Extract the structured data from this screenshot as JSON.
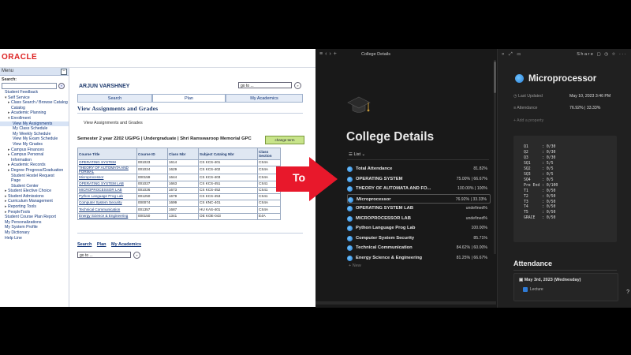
{
  "oracle": {
    "logo": "ORACLE",
    "menu": {
      "title": "Menu",
      "search_label": "Search:",
      "items": [
        {
          "label": "Student Feedback",
          "level": "l0"
        },
        {
          "label": "Self Service",
          "level": "l0",
          "arrow": "▾"
        },
        {
          "label": "Class Search / Browse Catalog",
          "level": "l1",
          "arrow": "▸"
        },
        {
          "label": "Catalog",
          "level": "l2b"
        },
        {
          "label": "Academic Planning",
          "level": "l1",
          "arrow": "▸"
        },
        {
          "label": "Enrollment",
          "level": "l1",
          "arrow": "▾"
        },
        {
          "label": "View My Assignments",
          "level": "l2",
          "selected": true
        },
        {
          "label": "My Class Schedule",
          "level": "l2"
        },
        {
          "label": "My Weekly Schedule",
          "level": "l2"
        },
        {
          "label": "View My Exam Schedule",
          "level": "l2"
        },
        {
          "label": "View My Grades",
          "level": "l2"
        },
        {
          "label": "Campus Finances",
          "level": "l1",
          "arrow": "▸"
        },
        {
          "label": "Campus Personal",
          "level": "l1",
          "arrow": "▸"
        },
        {
          "label": "Information",
          "level": "l2b"
        },
        {
          "label": "Academic Records",
          "level": "l1",
          "arrow": "▸"
        },
        {
          "label": "Degree Progress/Graduation",
          "level": "l1",
          "arrow": "▸"
        },
        {
          "label": "Student Hostel Request",
          "level": "l2b"
        },
        {
          "label": "Page",
          "level": "l2b"
        },
        {
          "label": "Student Center",
          "level": "l2b"
        },
        {
          "label": "Student Elective Choice",
          "level": "l0",
          "arrow": "▸"
        },
        {
          "label": "Student Admissions",
          "level": "l0",
          "arrow": "▸"
        },
        {
          "label": "Curriculum Management",
          "level": "l0",
          "arrow": "▸"
        },
        {
          "label": "Reporting Tools",
          "level": "l0",
          "arrow": "▸"
        },
        {
          "label": "PeopleTools",
          "level": "l0",
          "arrow": "▸"
        },
        {
          "label": "Student Course Plan Report",
          "level": "l0"
        },
        {
          "label": "My Personalizations",
          "level": "l0"
        },
        {
          "label": "My System Profile",
          "level": "l0"
        },
        {
          "label": "My Dictionary",
          "level": "l0"
        },
        {
          "label": "Help Line",
          "level": "l0"
        }
      ]
    },
    "user_name": "ARJUN VARSHNEY",
    "goto": "go to ...",
    "tabs": [
      "Search",
      "Plan",
      "My Academics"
    ],
    "heading": "View Assignments and Grades",
    "sub_heading": "View Assignments and Grades",
    "semester": "Semester 2 year 2202 UG/PG | Undergraduate | Shri Ramswaroop Memorial GPC",
    "change_term": "change term",
    "table": {
      "headers": [
        "Course Title",
        "Course ID",
        "Class Nbr",
        "Subject Catalog Nbr",
        "Class Section"
      ],
      "rows": [
        [
          "OPERATING SYSTEM",
          "001023",
          "1614",
          "CS KCS-401",
          "CS4A"
        ],
        [
          "THEORY OF AUTOMATA AND FORMAL",
          "001024",
          "1629",
          "CS KCS-402",
          "CS4A"
        ],
        [
          "Microprocessor",
          "000159",
          "1644",
          "CS KCS-403",
          "CS4A"
        ],
        [
          "OPERATING SYSTEM LAB",
          "001027",
          "1663",
          "CS KCS-451",
          "CS41"
        ],
        [
          "MICROPROCESSOR LAB",
          "001026",
          "1673",
          "CS KCS-452",
          "CS41"
        ],
        [
          "Python Language Prog Lab",
          "001250",
          "1679",
          "CS KCS-453",
          "CS41"
        ],
        [
          "Computer System Security",
          "000074",
          "1699",
          "CS KNC-401",
          "CS4A"
        ],
        [
          "Technical Communication",
          "001357",
          "1687",
          "HU KAS-401",
          "CS4A"
        ],
        [
          "Energy Science & Engineering",
          "000150",
          "1341",
          "OE KOE-043",
          "E4A"
        ]
      ]
    },
    "bottom_links": [
      "Search",
      "Plan",
      "My Academics"
    ],
    "goto_bottom": "go to ..."
  },
  "arrow_label": "To",
  "notion": {
    "breadcrumb": "College Details",
    "title": "College Details",
    "view_label": "List",
    "rows": [
      {
        "name": "Total Attendance",
        "value": "81.82%"
      },
      {
        "name": "OPERATING SYSTEM",
        "value": "75.00% | 66.67%"
      },
      {
        "name": "THEORY OF AUTOMATA AND FO...",
        "value": "100.00% | 100%"
      },
      {
        "name": "Microprocessor",
        "value": "76.92% | 33.33%",
        "selected": true
      },
      {
        "name": "OPERATING SYSTEM LAB",
        "value": "undefined%"
      },
      {
        "name": "MICROPROCESSOR LAB",
        "value": "undefined%"
      },
      {
        "name": "Python Language Prog Lab",
        "value": "100.00%"
      },
      {
        "name": "Computer System Security",
        "value": "85.71%"
      },
      {
        "name": "Technical Communication",
        "value": "84.62% | 60.00%"
      },
      {
        "name": "Energy Science & Engineering",
        "value": "81.25% | 66.67%"
      }
    ],
    "new_label": "+ New",
    "peek": {
      "share": "Share",
      "title": "Microprocessor",
      "props": [
        {
          "label": "Last Updated",
          "value": "May 10, 2023 3:46 PM"
        },
        {
          "label": "Attendance",
          "value": "76.92% | 33.33%"
        },
        {
          "label": "+ Add a property",
          "value": ""
        }
      ],
      "code": "Q1      : 0/30\nQ2      : 0/30\nQ3      : 0/30\nSQ1     : 5/5\nSQ2     : 0/5\nSQ3     : 0/5\nSQ4     : 0/5\nPre End : 0/100\nT1      : 0/50\nT2      : 0/50\nT3      : 0/50\nT4      : 0/50\nT5      : 0/50\nGRACE   : 0/50",
      "attendance_heading": "Attendance",
      "attendance_date": "May 3rd, 2023 (Wednesday)",
      "attendance_item": "Lecture"
    }
  },
  "colors": {
    "oracle_red": "#dd2222",
    "notion_bg": "#191919",
    "arrow_red": "#e8182b",
    "accent_blue": "#2b80d6"
  }
}
